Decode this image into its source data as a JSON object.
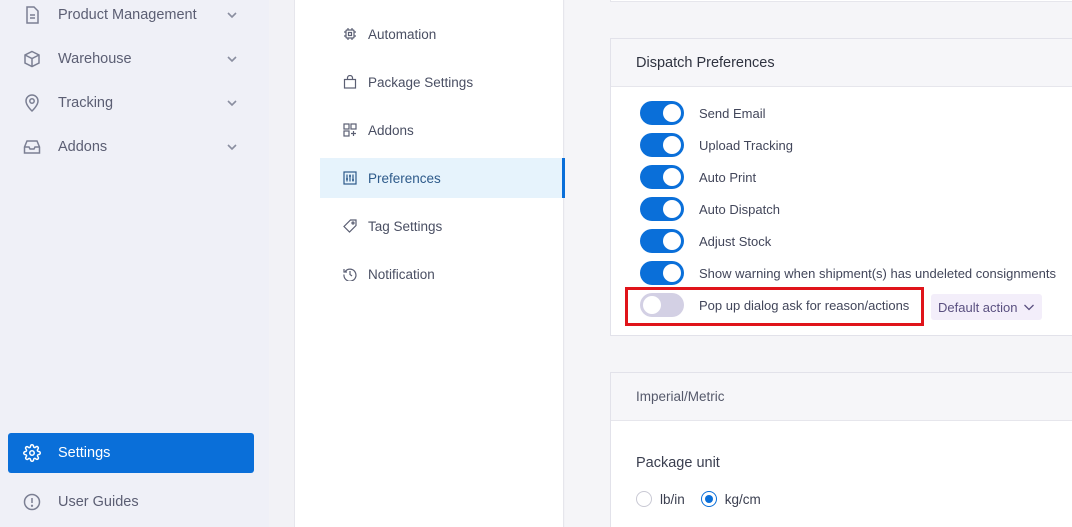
{
  "nav": {
    "items": [
      {
        "label": "Product Management"
      },
      {
        "label": "Warehouse"
      },
      {
        "label": "Tracking"
      },
      {
        "label": "Addons"
      }
    ],
    "settings_label": "Settings",
    "user_guides_label": "User Guides"
  },
  "submenu": {
    "items": [
      {
        "label": "Automation"
      },
      {
        "label": "Package Settings"
      },
      {
        "label": "Addons"
      },
      {
        "label": "Preferences"
      },
      {
        "label": "Tag Settings"
      },
      {
        "label": "Notification"
      }
    ],
    "active": "Preferences"
  },
  "dispatch": {
    "title": "Dispatch Preferences",
    "prefs": [
      {
        "label": "Send Email",
        "enabled": true
      },
      {
        "label": "Upload Tracking",
        "enabled": true
      },
      {
        "label": "Auto Print",
        "enabled": true
      },
      {
        "label": "Auto Dispatch",
        "enabled": true
      },
      {
        "label": "Adjust Stock",
        "enabled": true
      },
      {
        "label": "Show warning when shipment(s) has undeleted consignments",
        "enabled": true
      },
      {
        "label": "Pop up dialog ask for reason/actions",
        "enabled": false
      }
    ],
    "default_action_label": "Default action"
  },
  "units": {
    "title": "Imperial/Metric",
    "package_unit_label": "Package unit",
    "options": [
      {
        "label": "lb/in",
        "selected": false
      },
      {
        "label": "kg/cm",
        "selected": true
      }
    ]
  },
  "colors": {
    "accent": "#0a6fd9",
    "highlight": "#e0141a",
    "toggle_off": "#d3d0e4"
  }
}
